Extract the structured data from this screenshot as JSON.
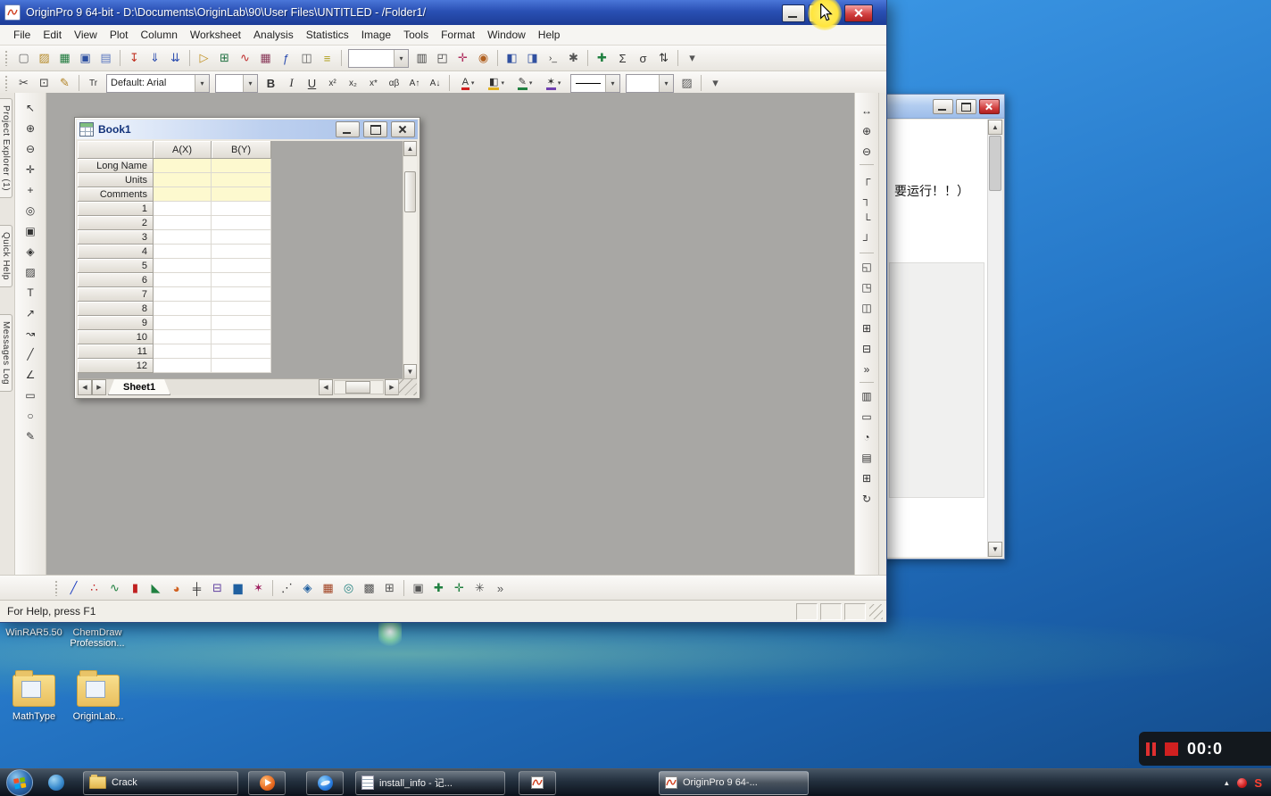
{
  "ui": {
    "dropdown_arrow": "▾",
    "left_arrow": "◀",
    "right_arrow": "▶",
    "up_arrow": "▲",
    "down_arrow": "▼",
    "app_icon_glyph": "∿"
  },
  "window": {
    "title": "OriginPro 9 64-bit - D:\\Documents\\OriginLab\\90\\User Files\\UNTITLED - /Folder1/"
  },
  "menu": {
    "items": [
      "File",
      "Edit",
      "View",
      "Plot",
      "Column",
      "Worksheet",
      "Analysis",
      "Statistics",
      "Image",
      "Tools",
      "Format",
      "Window",
      "Help"
    ]
  },
  "toolbars": {
    "standard_a": [
      {
        "n": "new-project-icon",
        "g": "▢",
        "c": "#6b6b6b"
      },
      {
        "n": "open-icon",
        "g": "▨",
        "c": "#b58a2a"
      },
      {
        "n": "open-excel-icon",
        "g": "▦",
        "c": "#1f7a3d"
      },
      {
        "n": "save-project-icon",
        "g": "▣",
        "c": "#2c4fa0"
      },
      {
        "n": "save-template-icon",
        "g": "▤",
        "c": "#5a77c0"
      },
      {
        "sep": true
      },
      {
        "n": "import-wizard-icon",
        "g": "↧",
        "c": "#c03020"
      },
      {
        "n": "import-single-ascii-icon",
        "g": "⇓",
        "c": "#3050b0"
      },
      {
        "n": "import-multiple-ascii-icon",
        "g": "⇊",
        "c": "#3050b0"
      },
      {
        "sep": true
      },
      {
        "n": "new-folder-icon",
        "g": "▷",
        "c": "#c09020"
      },
      {
        "n": "new-workbook-icon",
        "g": "⊞",
        "c": "#207040"
      },
      {
        "n": "new-graph-icon",
        "g": "∿",
        "c": "#c03030"
      },
      {
        "n": "new-matrix-icon",
        "g": "▦",
        "c": "#8a3a5a"
      },
      {
        "n": "new-function-plot-icon",
        "g": "ƒ",
        "c": "#3050b0"
      },
      {
        "n": "new-layout-icon",
        "g": "◫",
        "c": "#606060"
      },
      {
        "n": "new-notes-icon",
        "g": "≡",
        "c": "#b0a020"
      },
      {
        "sep": true
      }
    ],
    "standard_b": [
      {
        "n": "print-icon",
        "g": "▥",
        "c": "#444444"
      },
      {
        "n": "print-preview-icon",
        "g": "◰",
        "c": "#444444"
      },
      {
        "n": "digitizer-icon",
        "g": "✛",
        "c": "#b03060"
      },
      {
        "n": "screen-capture-icon",
        "g": "◉",
        "c": "#b06020"
      },
      {
        "sep": true
      },
      {
        "n": "project-explorer-icon",
        "g": "◧",
        "c": "#3050a0"
      },
      {
        "n": "results-log-icon",
        "g": "◨",
        "c": "#3050a0"
      },
      {
        "n": "command-window-icon",
        "g": "›_",
        "c": "#333333",
        "cls": "sm"
      },
      {
        "n": "code-builder-icon",
        "g": "✱",
        "c": "#555555"
      },
      {
        "sep": true
      },
      {
        "n": "add-new-columns-icon",
        "g": "✚",
        "c": "#208040"
      },
      {
        "n": "sum-icon",
        "g": "Σ",
        "c": "#333333"
      },
      {
        "n": "column-statistics-icon",
        "g": "σ",
        "c": "#333333"
      },
      {
        "n": "sort-icon",
        "g": "⇅",
        "c": "#333333"
      },
      {
        "sep": true
      },
      {
        "n": "standard-toolbar-chevron",
        "g": "▾",
        "c": "#555555"
      }
    ],
    "format_lead": [
      {
        "n": "cut-icon",
        "g": "✂",
        "c": "#444444"
      },
      {
        "n": "copy-icon",
        "g": "⊡",
        "c": "#444444"
      },
      {
        "n": "format-painter-icon",
        "g": "✎",
        "c": "#b08020"
      },
      {
        "sep": true
      },
      {
        "n": "font-style-icon",
        "g": "Tr",
        "c": "#333333",
        "cls": "sm"
      }
    ],
    "font_combo": "Default: Arial",
    "format_buttons": [
      {
        "n": "bold-button",
        "g": "B",
        "cls": "bold"
      },
      {
        "n": "italic-button",
        "g": "I",
        "cls": "ital"
      },
      {
        "n": "underline-button",
        "g": "U",
        "cls": "und"
      },
      {
        "n": "superscript-button",
        "g": "x²",
        "cls": "sm"
      },
      {
        "n": "subscript-button",
        "g": "x₂",
        "cls": "sm"
      },
      {
        "n": "sub-superscript-button",
        "g": "x*",
        "cls": "sm"
      },
      {
        "n": "greek-button",
        "g": "αβ",
        "cls": "sm"
      },
      {
        "n": "increase-font-button",
        "g": "A↑",
        "cls": "sm"
      },
      {
        "n": "decrease-font-button",
        "g": "A↓",
        "cls": "sm"
      },
      {
        "sep": true
      }
    ],
    "color_buttons": [
      {
        "n": "font-color-button",
        "ic": "A",
        "u": "#d02020"
      },
      {
        "n": "fill-color-button",
        "ic": "◧",
        "u": "#e0b020"
      },
      {
        "n": "line-color-button",
        "ic": "✎",
        "u": "#208040"
      },
      {
        "n": "symbol-color-button",
        "ic": "✶",
        "u": "#7040b0"
      }
    ],
    "format_tail": [
      {
        "n": "pattern-button",
        "g": "▨",
        "c": "#555555"
      },
      {
        "sep": true
      },
      {
        "n": "format-toolbar-chevron",
        "g": "▾",
        "c": "#555555"
      }
    ]
  },
  "tools_left": {
    "tabs": [
      {
        "n": "tab-project-explorer",
        "label": "Project Explorer (1)"
      },
      {
        "n": "tab-quick-help",
        "label": "Quick Help"
      },
      {
        "n": "tab-messages-log",
        "label": "Messages Log"
      }
    ],
    "tools": [
      {
        "n": "pointer-tool",
        "g": "↖"
      },
      {
        "n": "zoom-in-tool",
        "g": "⊕"
      },
      {
        "n": "zoom-out-tool",
        "g": "⊖"
      },
      {
        "n": "pan-tool",
        "g": "✛"
      },
      {
        "n": "screen-reader-tool",
        "g": "+"
      },
      {
        "n": "data-reader-tool",
        "g": "◎"
      },
      {
        "n": "data-selector-tool",
        "g": "▣"
      },
      {
        "n": "selection-on-plot-tool",
        "g": "◈"
      },
      {
        "n": "mask-tool",
        "g": "▨"
      },
      {
        "n": "text-tool",
        "g": "T"
      },
      {
        "n": "arrow-tool",
        "g": "↗"
      },
      {
        "n": "curved-arrow-tool",
        "g": "↝"
      },
      {
        "n": "line-tool",
        "g": "╱"
      },
      {
        "n": "polyline-tool",
        "g": "∠"
      },
      {
        "n": "rectangle-tool",
        "g": "▭"
      },
      {
        "n": "circle-tool",
        "g": "○"
      },
      {
        "n": "freehand-tool",
        "g": "✎"
      }
    ]
  },
  "right_dock": {
    "items": [
      {
        "n": "graph-rescale-icon",
        "g": "↔"
      },
      {
        "n": "graph-zoom-in-icon",
        "g": "⊕"
      },
      {
        "n": "graph-zoom-out-icon",
        "g": "⊖"
      },
      {
        "sep": true
      },
      {
        "n": "add-top-x-axis-icon",
        "g": "┌"
      },
      {
        "n": "add-right-y-axis-icon",
        "g": "┐"
      },
      {
        "n": "add-bottom-axis-icon",
        "g": "└"
      },
      {
        "n": "add-corner-axes-icon",
        "g": "┘"
      },
      {
        "sep": true
      },
      {
        "n": "add-inset-graph-icon",
        "g": "◱"
      },
      {
        "n": "add-inset-data-icon",
        "g": "◳"
      },
      {
        "n": "merge-graphs-icon",
        "g": "◫"
      },
      {
        "n": "extract-to-layers-icon",
        "g": "⊞"
      },
      {
        "n": "extract-to-graphs-icon",
        "g": "⊟"
      },
      {
        "n": "dock-chevron",
        "g": "»"
      },
      {
        "sep": true
      },
      {
        "n": "add-color-scale-icon",
        "g": "▥"
      },
      {
        "n": "new-legend-icon",
        "g": "▭"
      },
      {
        "n": "date-time-icon",
        "g": "◔"
      },
      {
        "n": "layer-management-icon",
        "g": "▤"
      },
      {
        "n": "worksheet-grid-icon",
        "g": "⊞"
      },
      {
        "n": "refresh-icon",
        "g": "↻"
      }
    ]
  },
  "plot_toolbar": {
    "items": [
      {
        "n": "line-plot-icon",
        "g": "╱",
        "c": "#2040c0"
      },
      {
        "n": "scatter-plot-icon",
        "g": "∴",
        "c": "#c02020"
      },
      {
        "n": "line-symbol-plot-icon",
        "g": "∿",
        "c": "#208040"
      },
      {
        "n": "column-plot-icon",
        "g": "▮",
        "c": "#c02020"
      },
      {
        "n": "area-plot-icon",
        "g": "◣",
        "c": "#208040"
      },
      {
        "n": "pie-chart-icon",
        "g": "◕",
        "c": "#d06020"
      },
      {
        "n": "hi-lo-close-plot-icon",
        "g": "╪",
        "c": "#333333"
      },
      {
        "n": "box-chart-icon",
        "g": "⊟",
        "c": "#6040a0"
      },
      {
        "n": "histogram-icon",
        "g": "▆",
        "c": "#2060a0"
      },
      {
        "n": "polar-plot-icon",
        "g": "✶",
        "c": "#a02060"
      },
      {
        "sep": true
      },
      {
        "n": "plot-3d-scatter-icon",
        "g": "⋰",
        "c": "#333333"
      },
      {
        "n": "plot-3d-surface-icon",
        "g": "◈",
        "c": "#2060a0"
      },
      {
        "n": "plot-3d-bars-icon",
        "g": "▦",
        "c": "#a04020"
      },
      {
        "n": "contour-plot-icon",
        "g": "◎",
        "c": "#208080"
      },
      {
        "n": "image-plot-icon",
        "g": "▩",
        "c": "#555555"
      },
      {
        "n": "multi-panel-icon",
        "g": "⊞",
        "c": "#555555"
      },
      {
        "sep": true
      },
      {
        "n": "template-library-icon",
        "g": "▣",
        "c": "#555555"
      },
      {
        "n": "add-graph-icon",
        "g": "✚",
        "c": "#208040"
      },
      {
        "n": "add-layer-icon",
        "g": "✛",
        "c": "#208040"
      },
      {
        "n": "plot-setup-icon",
        "g": "✳",
        "c": "#555555"
      },
      {
        "n": "plot-toolbar-chevron",
        "g": "»",
        "c": "#555555"
      }
    ]
  },
  "book1": {
    "title": "Book1",
    "columns": [
      "A(X)",
      "B(Y)"
    ],
    "label_rows": [
      "Long Name",
      "Units",
      "Comments"
    ],
    "data_rows": [
      "1",
      "2",
      "3",
      "4",
      "5",
      "6",
      "7",
      "8",
      "9",
      "10",
      "11",
      "12"
    ],
    "sheet_tab": "Sheet1"
  },
  "status_bar": {
    "text": "For Help, press F1"
  },
  "background_window": {
    "text_line": "要运行！！）"
  },
  "desktop": {
    "labels": [
      "WinRAR5.50",
      "ChemDraw Profession..."
    ],
    "folders": [
      {
        "n": "desktop-icon-mathtype",
        "label": "MathType"
      },
      {
        "n": "desktop-icon-originlab",
        "label": "OriginLab..."
      }
    ]
  },
  "taskbar": {
    "buttons": {
      "crack": "Crack",
      "notepad": "install_info - 记...",
      "originpro": "OriginPro 9 64-..."
    },
    "tray_s": "S"
  },
  "recorder": {
    "time": "00:0"
  }
}
